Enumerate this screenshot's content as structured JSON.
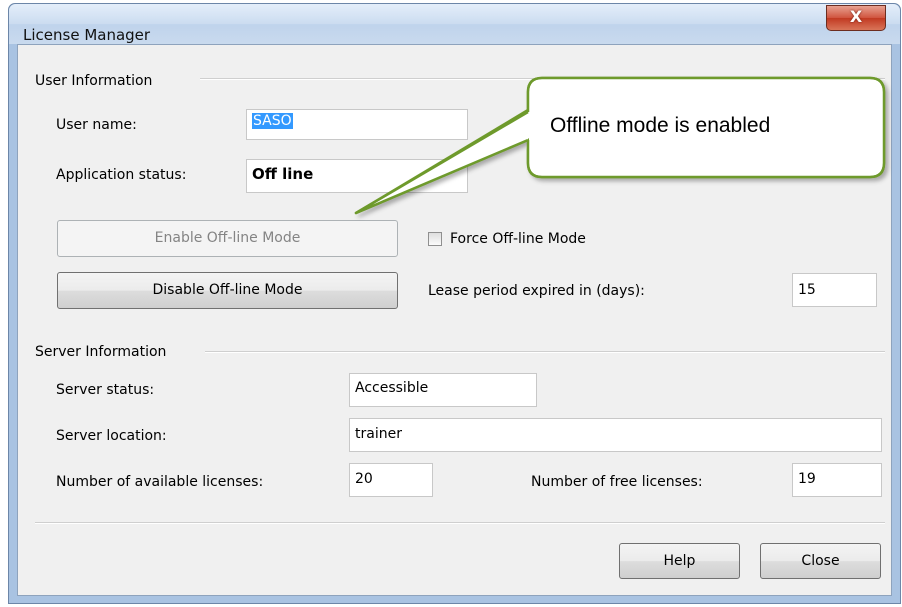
{
  "window": {
    "title": "License Manager",
    "close_label": "X"
  },
  "user_info": {
    "group_title": "User Information",
    "user_name_label": "User name:",
    "user_name_value": "SASO",
    "app_status_label": "Application status:",
    "app_status_value": "Off line",
    "enable_button": "Enable Off-line Mode",
    "disable_button": "Disable Off-line Mode",
    "force_offline_label": "Force Off-line Mode",
    "force_offline_checked": false,
    "lease_label": "Lease period expired in (days):",
    "lease_value": "15"
  },
  "server_info": {
    "group_title": "Server Information",
    "status_label": "Server status:",
    "status_value": "Accessible",
    "location_label": "Server location:",
    "location_value": "trainer",
    "available_label": "Number of available licenses:",
    "available_value": "20",
    "free_label": "Number of free licenses:",
    "free_value": "19"
  },
  "buttons": {
    "help": "Help",
    "close": "Close"
  },
  "callout": {
    "text": "Offline mode is enabled",
    "border_color": "#6e9a2c"
  }
}
